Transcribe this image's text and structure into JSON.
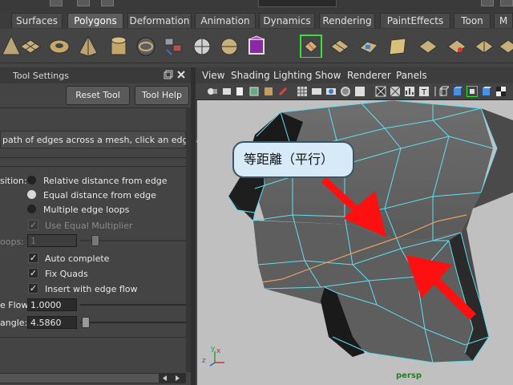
{
  "shelf_tabs": [
    {
      "label": "Surfaces",
      "active": false
    },
    {
      "label": "Polygons",
      "active": true
    },
    {
      "label": "Deformation",
      "active": false
    },
    {
      "label": "Animation",
      "active": false
    },
    {
      "label": "Dynamics",
      "active": false
    },
    {
      "label": "Rendering",
      "active": false
    },
    {
      "label": "PaintEffects",
      "active": false
    },
    {
      "label": "Toon",
      "active": false
    },
    {
      "label": "M",
      "active": false
    }
  ],
  "tool_settings": {
    "title": "Tool Settings",
    "reset_label": "Reset Tool",
    "help_label": "Tool Help",
    "description": "path of edges across a mesh, click an edge and d",
    "position_label": "sition:",
    "radio_options": [
      {
        "label": "Relative distance from edge",
        "selected": false
      },
      {
        "label": "Equal distance from edge",
        "selected": true
      },
      {
        "label": "Multiple edge loops",
        "selected": false
      }
    ],
    "use_equal_multiplier": {
      "label": "Use Equal Multiplier",
      "checked": true,
      "enabled": false
    },
    "loops_label": "oops:",
    "loops_value": "1",
    "auto_complete": {
      "label": "Auto complete",
      "checked": true
    },
    "fix_quads": {
      "label": "Fix Quads",
      "checked": true
    },
    "insert_flow": {
      "label": "Insert with edge flow",
      "checked": true
    },
    "flow_label": "e Flow",
    "flow_value": "1.0000",
    "angle_label": "angle:",
    "angle_value": "4.5860"
  },
  "viewport": {
    "menus": [
      "View",
      "Shading",
      "Lighting",
      "Show",
      "Renderer",
      "Panels"
    ],
    "camera_label": "persp",
    "callout_text": "等距離（平行）",
    "axis": {
      "x": "x",
      "y": "y",
      "z": "z"
    }
  },
  "colors": {
    "accent": "#5d5d5d",
    "wire": "#5fe0f0",
    "edge_loop": "#e8a060",
    "arrow": "#ff1010"
  }
}
